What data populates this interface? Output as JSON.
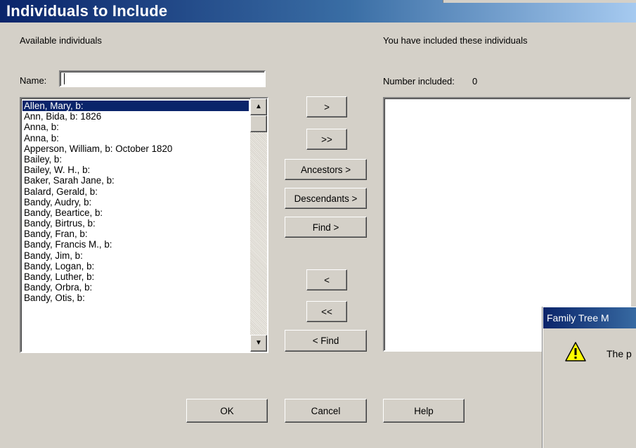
{
  "window": {
    "title": "Individuals to Include"
  },
  "available": {
    "header": "Available individuals",
    "name_label": "Name:",
    "name_value": "",
    "items": [
      "Allen, Mary, b:",
      "Ann, Bida, b: 1826",
      "Anna, b:",
      "Anna, b:",
      "Apperson, William, b: October 1820",
      "Bailey, b:",
      "Bailey, W. H., b:",
      "Baker, Sarah Jane, b:",
      "Balard, Gerald, b:",
      "Bandy, Audry, b:",
      "Bandy, Beartice, b:",
      "Bandy, Birtrus, b:",
      "Bandy, Fran, b:",
      "Bandy, Francis M., b:",
      "Bandy, Jim, b:",
      "Bandy, Logan, b:",
      "Bandy, Luther, b:",
      "Bandy, Orbra, b:",
      "Bandy, Otis, b:"
    ],
    "selected_index": 0
  },
  "transfer_buttons": {
    "add": ">",
    "add_all": ">>",
    "ancestors": "Ancestors >",
    "descendants": "Descendants >",
    "find": "Find >",
    "remove": "<",
    "remove_all": "<<",
    "find_remove": "< Find"
  },
  "included": {
    "header": "You have included these individuals",
    "count_label": "Number included:",
    "count": "0"
  },
  "footer": {
    "ok": "OK",
    "cancel": "Cancel",
    "help": "Help"
  },
  "message_box": {
    "title": "Family Tree M",
    "text": "The p",
    "icon": "warning-icon"
  },
  "colors": {
    "face": "#d4d0c8",
    "selection": "#0a246a",
    "title_start": "#0a246a",
    "title_end": "#a6caf0"
  }
}
